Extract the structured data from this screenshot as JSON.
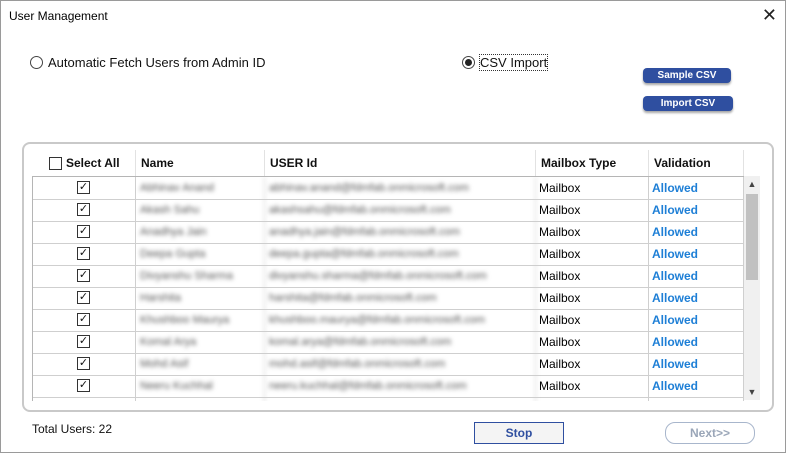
{
  "window": {
    "title": "User Management"
  },
  "options": {
    "auto_fetch_label": "Automatic Fetch Users from Admin ID",
    "csv_import_label": "CSV Import",
    "selected": "csv_import"
  },
  "buttons": {
    "sample_csv": "Sample CSV",
    "import_csv": "Import CSV",
    "stop": "Stop",
    "next": "Next>>"
  },
  "table": {
    "columns": {
      "select_all": "Select All",
      "name": "Name",
      "user_id": "USER Id",
      "mailbox_type": "Mailbox Type",
      "validation": "Validation"
    },
    "rows": [
      {
        "checked": true,
        "name": "Abhinav Anand",
        "user_id": "abhinav.anand@fdmfab.onmicrosoft.com",
        "mailbox_type": "Mailbox",
        "validation": "Allowed"
      },
      {
        "checked": true,
        "name": "Akash Sahu",
        "user_id": "akashsahu@fdmfab.onmicrosoft.com",
        "mailbox_type": "Mailbox",
        "validation": "Allowed"
      },
      {
        "checked": true,
        "name": "Anadhya Jain",
        "user_id": "anadhya.jain@fdmfab.onmicrosoft.com",
        "mailbox_type": "Mailbox",
        "validation": "Allowed"
      },
      {
        "checked": true,
        "name": "Deepa Gupta",
        "user_id": "deepa.gupta@fdmfab.onmicrosoft.com",
        "mailbox_type": "Mailbox",
        "validation": "Allowed"
      },
      {
        "checked": true,
        "name": "Divyanshu Sharma",
        "user_id": "divyanshu.sharma@fdmfab.onmicrosoft.com",
        "mailbox_type": "Mailbox",
        "validation": "Allowed"
      },
      {
        "checked": true,
        "name": "Harshita",
        "user_id": "harshita@fdmfab.onmicrosoft.com",
        "mailbox_type": "Mailbox",
        "validation": "Allowed"
      },
      {
        "checked": true,
        "name": "Khushboo Maurya",
        "user_id": "khushboo.maurya@fdmfab.onmicrosoft.com",
        "mailbox_type": "Mailbox",
        "validation": "Allowed"
      },
      {
        "checked": true,
        "name": "Komal Arya",
        "user_id": "komal.arya@fdmfab.onmicrosoft.com",
        "mailbox_type": "Mailbox",
        "validation": "Allowed"
      },
      {
        "checked": true,
        "name": "Mohd Asif",
        "user_id": "mohd.asif@fdmfab.onmicrosoft.com",
        "mailbox_type": "Mailbox",
        "validation": "Allowed"
      },
      {
        "checked": true,
        "name": "Neeru Kuchhal",
        "user_id": "neeru.kuchhal@fdmfab.onmicrosoft.com",
        "mailbox_type": "Mailbox",
        "validation": "Allowed"
      },
      {
        "checked": true,
        "name": "",
        "user_id": "",
        "mailbox_type": "",
        "validation": ""
      }
    ]
  },
  "footer": {
    "total_users": "Total Users: 22"
  },
  "colors": {
    "accent": "#2f4fa0",
    "allowed": "#1e7fd6"
  }
}
